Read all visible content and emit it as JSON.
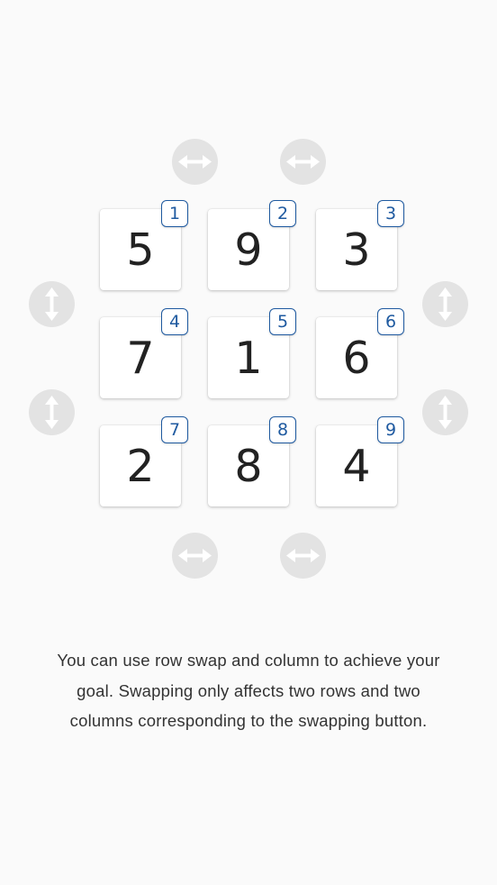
{
  "board": {
    "tiles": [
      {
        "value": "5",
        "index": "1"
      },
      {
        "value": "9",
        "index": "2"
      },
      {
        "value": "3",
        "index": "3"
      },
      {
        "value": "7",
        "index": "4"
      },
      {
        "value": "1",
        "index": "5"
      },
      {
        "value": "6",
        "index": "6"
      },
      {
        "value": "2",
        "index": "7"
      },
      {
        "value": "8",
        "index": "8"
      },
      {
        "value": "4",
        "index": "9"
      }
    ]
  },
  "controls": {
    "column_swap_icon": "horizontal-double-arrow-icon",
    "row_swap_icon": "vertical-double-arrow-icon",
    "button_color": "#e3e3e3",
    "icon_color": "#ffffff"
  },
  "colors": {
    "badge": "#1f5aa0",
    "tile_text": "#222222",
    "background": "#fafafa"
  },
  "instructions": "You can use row swap and column to achieve your goal. Swapping only affects two rows and two columns corresponding to the swapping button."
}
